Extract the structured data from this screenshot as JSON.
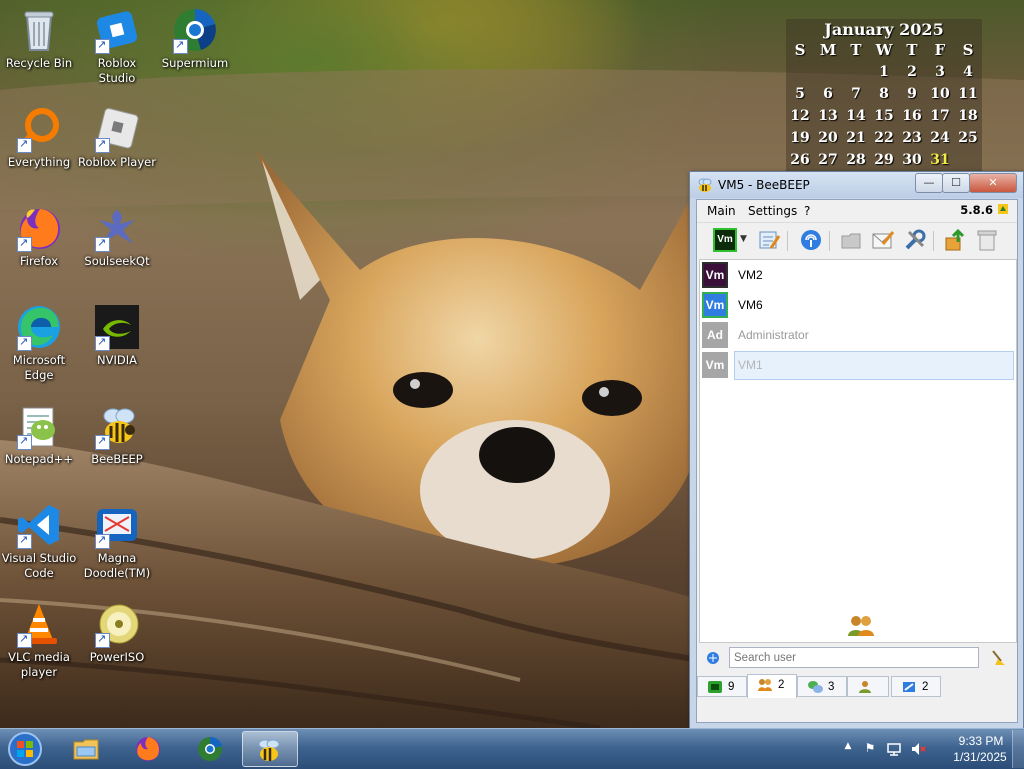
{
  "desktop": {
    "icons": [
      {
        "label": "Recycle Bin",
        "icon": "recycle-bin-icon"
      },
      {
        "label": "Roblox Studio",
        "icon": "roblox-studio-icon"
      },
      {
        "label": "Supermium",
        "icon": "supermium-icon"
      },
      {
        "label": "Everything",
        "icon": "everything-icon"
      },
      {
        "label": "Roblox Player",
        "icon": "roblox-player-icon"
      },
      {
        "label": "Firefox",
        "icon": "firefox-icon"
      },
      {
        "label": "SoulseekQt",
        "icon": "soulseekqt-icon"
      },
      {
        "label": "Microsoft Edge",
        "icon": "edge-icon"
      },
      {
        "label": "NVIDIA",
        "icon": "nvidia-icon"
      },
      {
        "label": "Notepad++",
        "icon": "notepadpp-icon"
      },
      {
        "label": "BeeBEEP",
        "icon": "beebeep-icon"
      },
      {
        "label": "Visual Studio Code",
        "icon": "vscode-icon"
      },
      {
        "label": "Magna Doodle(TM)",
        "icon": "magna-doodle-icon"
      },
      {
        "label": "VLC media player",
        "icon": "vlc-icon"
      },
      {
        "label": "PowerISO",
        "icon": "poweriso-icon"
      }
    ]
  },
  "calendar": {
    "title": "January 2025",
    "weekdays": [
      "S",
      "M",
      "T",
      "W",
      "T",
      "F",
      "S"
    ],
    "days": [
      "",
      "",
      "",
      "1",
      "2",
      "3",
      "4",
      "5",
      "6",
      "7",
      "8",
      "9",
      "10",
      "11",
      "12",
      "13",
      "14",
      "15",
      "16",
      "17",
      "18",
      "19",
      "20",
      "21",
      "22",
      "23",
      "24",
      "25",
      "26",
      "27",
      "28",
      "29",
      "30",
      "31",
      ""
    ],
    "today": "31",
    "today_color": "#f2ec48"
  },
  "beebeep": {
    "title": "VM5 - BeeBEEP",
    "menu": [
      "Main",
      "Settings",
      "?"
    ],
    "version": "5.8.6",
    "captions": {
      "minimize": "—",
      "maximize": "☐",
      "close": "✕"
    },
    "status_avatar": "Vm",
    "users": [
      {
        "avatar": "Vm",
        "name": "VM2",
        "color": "#3a0f3a",
        "border": "#2e2e2e",
        "online": true
      },
      {
        "avatar": "Vm",
        "name": "VM6",
        "color": "#2f7de1",
        "border": "#30b050",
        "online": true
      },
      {
        "avatar": "Ad",
        "name": "Administrator",
        "color": "#a6a6a6",
        "border": "#a6a6a6",
        "online": false
      },
      {
        "avatar": "Vm",
        "name": "VM1",
        "color": "#a6a6a6",
        "border": "#a6a6a6",
        "online": false
      }
    ],
    "search_placeholder": "Search user",
    "tabs": [
      {
        "name": "users",
        "count": "9"
      },
      {
        "name": "groups",
        "count": "2"
      },
      {
        "name": "chats",
        "count": "3"
      },
      {
        "name": "members",
        "count": ""
      },
      {
        "name": "shares",
        "count": "2"
      }
    ]
  },
  "taskbar": {
    "apps": [
      "explorer-icon",
      "firefox-icon",
      "supermium-icon",
      "beebeep-icon"
    ],
    "active_app": "beebeep-icon",
    "clock": {
      "time": "9:33 PM",
      "date": "1/31/2025"
    }
  }
}
